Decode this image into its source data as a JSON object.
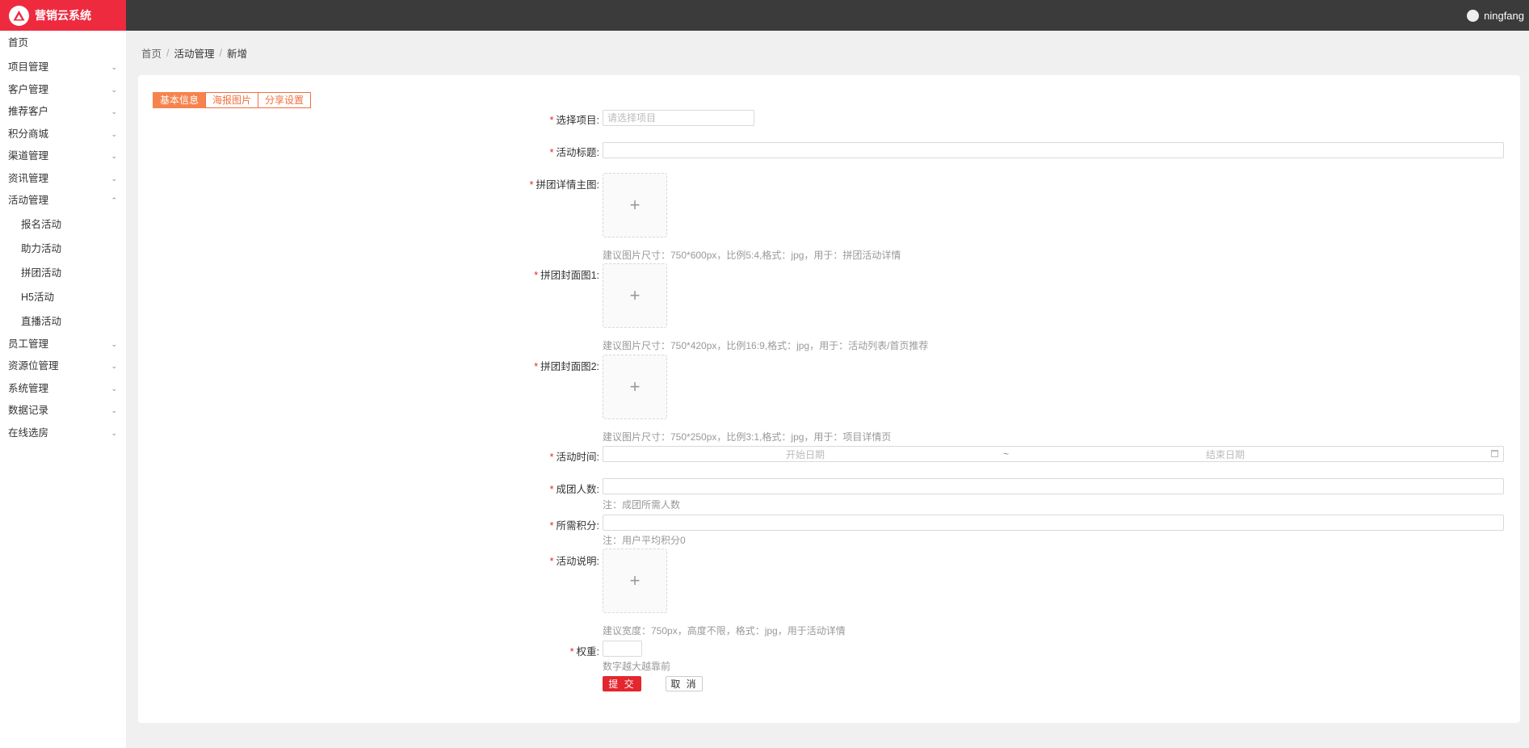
{
  "app": {
    "title": "营销云系统"
  },
  "user": {
    "name": "ningfang"
  },
  "sidebar": {
    "items": [
      {
        "label": "首页"
      },
      {
        "label": "项目管理",
        "chevron": "chevron-down-icon"
      },
      {
        "label": "客户管理",
        "chevron": "chevron-down-icon"
      },
      {
        "label": "推荐客户",
        "chevron": "chevron-down-icon"
      },
      {
        "label": "积分商城",
        "chevron": "chevron-down-icon"
      },
      {
        "label": "渠道管理",
        "chevron": "chevron-down-icon"
      },
      {
        "label": "资讯管理",
        "chevron": "chevron-down-icon"
      },
      {
        "label": "活动管理",
        "chevron": "chevron-up-icon"
      },
      {
        "label": "员工管理",
        "chevron": "chevron-down-icon"
      },
      {
        "label": "资源位管理",
        "chevron": "chevron-down-icon"
      },
      {
        "label": "系统管理",
        "chevron": "chevron-down-icon"
      },
      {
        "label": "数据记录",
        "chevron": "chevron-down-icon"
      },
      {
        "label": "在线选房",
        "chevron": "chevron-down-icon"
      }
    ],
    "activity_sub": [
      {
        "label": "报名活动"
      },
      {
        "label": "助力活动"
      },
      {
        "label": "拼团活动"
      },
      {
        "label": "H5活动"
      },
      {
        "label": "直播活动"
      }
    ]
  },
  "breadcrumb": {
    "home": "首页",
    "section": "活动管理",
    "current": "新增",
    "sep": "/"
  },
  "tabs": [
    {
      "label": "基本信息",
      "active": true
    },
    {
      "label": "海报图片",
      "active": false
    },
    {
      "label": "分享设置",
      "active": false
    }
  ],
  "form": {
    "required_mark": "*",
    "project": {
      "label": "选择项目:",
      "placeholder": "请选择项目",
      "value": ""
    },
    "title": {
      "label": "活动标题:",
      "value": ""
    },
    "detail_image": {
      "label": "拼团详情主图:",
      "hint": "建议图片尺寸：750*600px，比例5:4,格式：jpg，用于：拼团活动详情"
    },
    "cover1": {
      "label": "拼团封面图1:",
      "hint": "建议图片尺寸：750*420px，比例16:9,格式：jpg，用于：活动列表/首页推荐"
    },
    "cover2": {
      "label": "拼团封面图2:",
      "hint": "建议图片尺寸：750*250px，比例3:1,格式：jpg，用于：项目详情页"
    },
    "time": {
      "label": "活动时间:",
      "start": "开始日期",
      "sep": "~",
      "end": "结束日期"
    },
    "group_size": {
      "label": "成团人数:",
      "hint": "注：成团所需人数",
      "value": ""
    },
    "points": {
      "label": "所需积分:",
      "hint": "注：用户平均积分0",
      "value": ""
    },
    "description": {
      "label": "活动说明:",
      "hint": "建议宽度：750px，高度不限，格式：jpg，用于活动详情"
    },
    "weight": {
      "label": "权重:",
      "hint": "数字越大越靠前",
      "value": ""
    },
    "upload_symbol": "+",
    "submit_label": "提 交",
    "cancel_label": "取 消"
  },
  "colors": {
    "brand": "#ee2a3f",
    "topbar": "#3b3b3b",
    "tab_accent": "#f26e3d",
    "required": "#e4262f",
    "submit": "#e4262f"
  }
}
